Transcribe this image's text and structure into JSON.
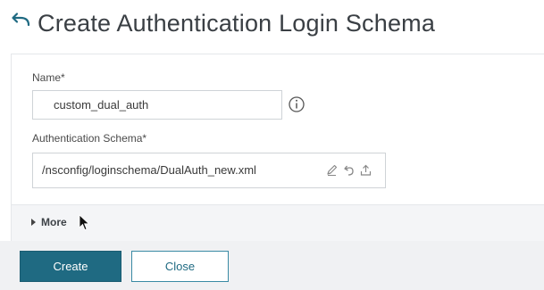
{
  "header": {
    "title": "Create Authentication Login Schema",
    "back_icon": "back-arrow-icon"
  },
  "form": {
    "name_label": "Name*",
    "name_value": "custom_dual_auth",
    "info_icon": "info-icon",
    "schema_label": "Authentication Schema*",
    "schema_value": "/nsconfig/loginschema/DualAuth_new.xml",
    "schema_icons": [
      "edit-icon",
      "undo-icon",
      "upload-icon"
    ],
    "more_label": "More"
  },
  "footer": {
    "create_label": "Create",
    "close_label": "Close"
  },
  "colors": {
    "primary": "#1f6a82",
    "footer_bg": "#f0f1f3",
    "more_bar_bg": "#f4f5f7"
  }
}
